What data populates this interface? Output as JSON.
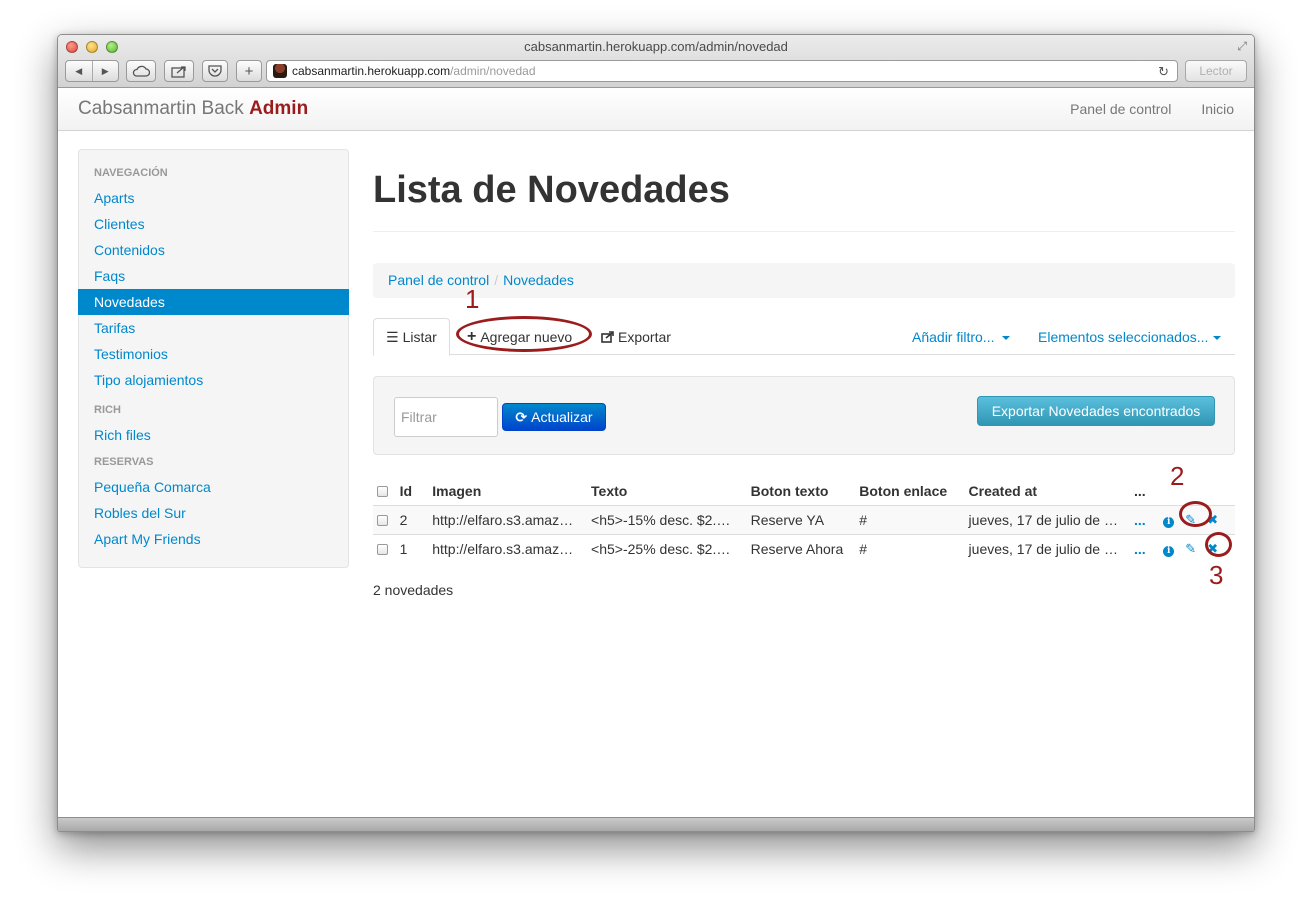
{
  "browser": {
    "window_title": "cabsanmartin.herokuapp.com/admin/novedad",
    "url_host": "cabsanmartin.herokuapp.com",
    "url_path": "/admin/novedad",
    "reader_label": "Lector",
    "back_glyph": "◀",
    "forward_glyph": "▶",
    "new_tab_glyph": "+",
    "reload_glyph": "↻"
  },
  "navbar": {
    "brand": "Cabsanmartin Back",
    "brand_highlight": "Admin",
    "links": [
      "Panel de control",
      "Inicio"
    ]
  },
  "sidebar": {
    "sections": [
      {
        "header": "Navegación",
        "items": [
          "Aparts",
          "Clientes",
          "Contenidos",
          "Faqs",
          "Novedades",
          "Tarifas",
          "Testimonios",
          "Tipo alojamientos"
        ]
      },
      {
        "header": "Rich",
        "items": [
          "Rich files"
        ]
      },
      {
        "header": "Reservas",
        "items": [
          "Pequeña Comarca",
          "Robles del Sur",
          "Apart My Friends"
        ]
      }
    ],
    "active_item": "Novedades"
  },
  "main": {
    "title": "Lista de Novedades",
    "breadcrumb": [
      "Panel de control",
      "Novedades"
    ],
    "tabs": {
      "list": "Listar",
      "add": "Agregar nuevo",
      "export": "Exportar",
      "add_filter": "Añadir filtro...",
      "selected": "Elementos seleccionados..."
    },
    "filter_placeholder": "Filtrar",
    "update_button": "Actualizar",
    "export_button": "Exportar Novedades encontrados",
    "table": {
      "headers": [
        "Id",
        "Imagen",
        "Texto",
        "Boton texto",
        "Boton enlace",
        "Created at",
        "..."
      ],
      "rows": [
        {
          "id": "2",
          "imagen": "http://elfaro.s3.amaz…",
          "texto": "<h5>-15% desc. $2.…",
          "boton_texto": "Reserve YA",
          "boton_enlace": "#",
          "created_at": "jueves, 17 de julio de …",
          "more": "..."
        },
        {
          "id": "1",
          "imagen": "http://elfaro.s3.amaz…",
          "texto": "<h5>-25% desc. $2.…",
          "boton_texto": "Reserve Ahora",
          "boton_enlace": "#",
          "created_at": "jueves, 17 de julio de …",
          "more": "..."
        }
      ]
    },
    "count": "2 novedades"
  },
  "annotations": [
    "1",
    "2",
    "3"
  ],
  "colors": {
    "link": "#0088cc",
    "brand_accent": "#9b1c1c",
    "annotation": "#9b1c1c"
  }
}
